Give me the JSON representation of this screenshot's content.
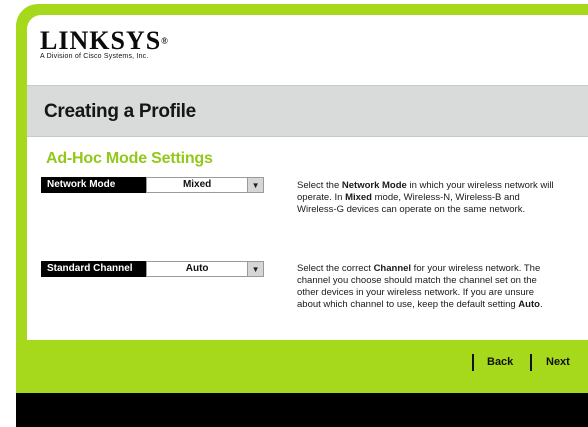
{
  "logo": {
    "name": "LINKSYS",
    "tagline": "A Division of Cisco Systems, Inc."
  },
  "page_title": "Creating a Profile",
  "section_title": "Ad-Hoc Mode Settings",
  "fields": [
    {
      "label": "Network Mode",
      "value": "Mixed",
      "desc_parts": [
        "Select the ",
        "Network Mode",
        " in which your wireless network will operate. In ",
        "Mixed",
        " mode, Wireless-N, Wireless-B and Wireless-G devices can operate on the same network."
      ]
    },
    {
      "label": "Standard Channel",
      "value": "Auto",
      "desc_parts": [
        "Select the correct ",
        "Channel",
        " for your wireless network. The channel you choose should match the channel set on the other devices in your wireless network. If you are unsure about which channel to use, keep the default setting ",
        "Auto",
        "."
      ]
    }
  ],
  "nav": {
    "back": "Back",
    "next": "Next"
  },
  "colors": {
    "accent": "#a6d81c",
    "section_title": "#93c81b",
    "band": "#d9dada"
  }
}
